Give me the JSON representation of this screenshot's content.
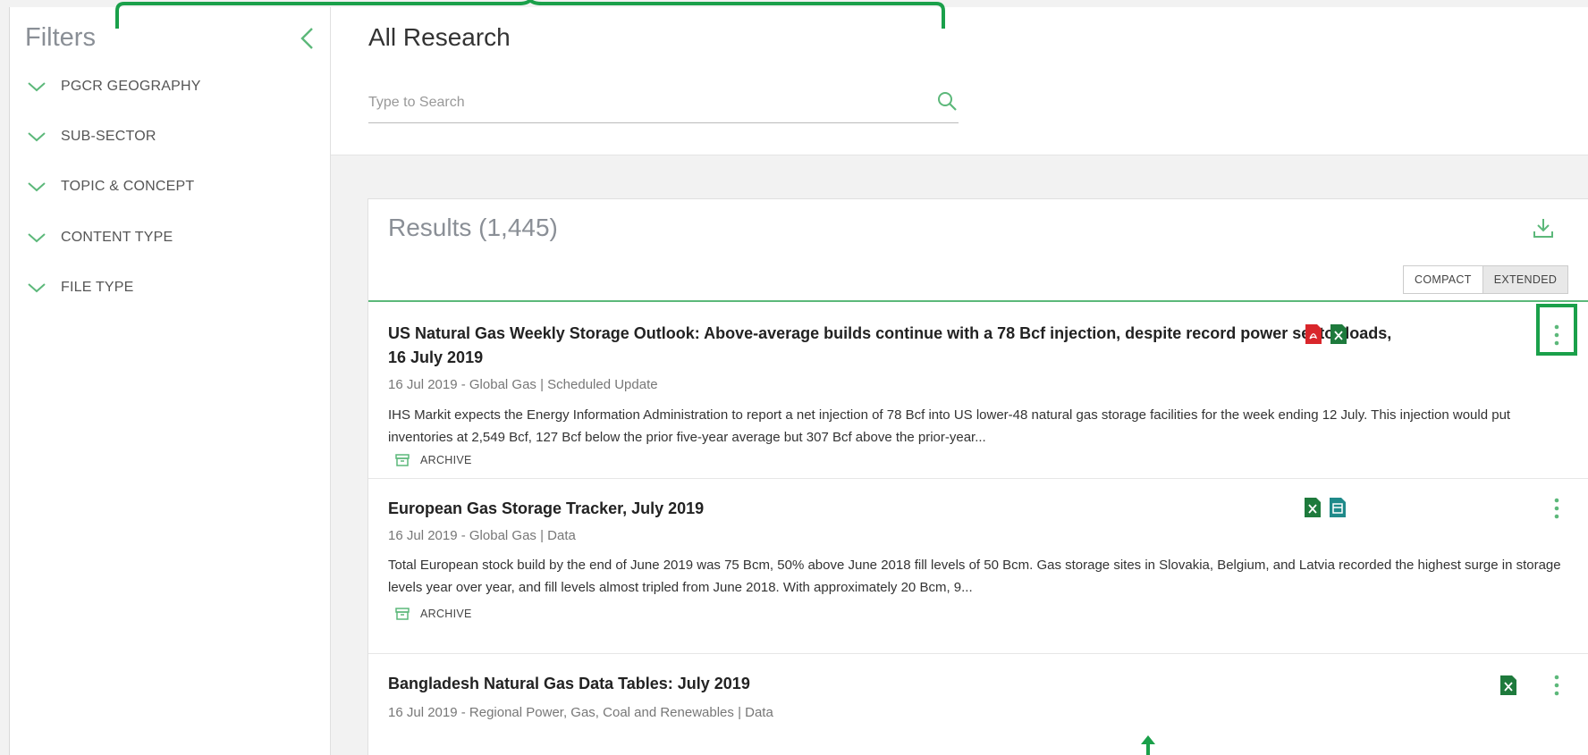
{
  "sidebar": {
    "title": "Filters",
    "filters": [
      {
        "label": "PGCR GEOGRAPHY"
      },
      {
        "label": "SUB-SECTOR"
      },
      {
        "label": "TOPIC & CONCEPT"
      },
      {
        "label": "CONTENT TYPE"
      },
      {
        "label": "FILE TYPE"
      }
    ]
  },
  "header": {
    "title": "All Research",
    "search": {
      "placeholder": "Type to Search",
      "value": ""
    }
  },
  "results": {
    "title": "Results (1,445)",
    "view_options": [
      "COMPACT",
      "EXTENDED"
    ],
    "active_view": "EXTENDED",
    "items": [
      {
        "title": "US Natural Gas Weekly Storage Outlook: Above-average builds continue with a 78 Bcf injection, despite record power sector loads, 16 July 2019",
        "meta": "16 Jul 2019 - Global Gas | Scheduled Update",
        "description": "IHS Markit expects the Energy Information Administration to report a net injection of 78 Bcf into US lower-48 natural gas storage facilities for the week ending 12 July. This injection would put inventories at 2,549 Bcf, 127 Bcf below the prior five-year average but 307 Bcf above the prior-year...",
        "archive_label": "ARCHIVE",
        "file_icons": [
          "pdf-icon",
          "excel-icon"
        ]
      },
      {
        "title": "European Gas Storage Tracker, July 2019",
        "meta": "16 Jul 2019 - Global Gas | Data",
        "description": "Total European stock build by the end of June 2019 was 75 Bcm, 50% above June 2018 fill levels of 50 Bcm. Gas storage sites in Slovakia, Belgium, and Latvia recorded the highest surge in storage levels year over year, and fill levels almost tripled from June 2018. With approximately 20 Bcm, 9...",
        "archive_label": "ARCHIVE",
        "file_icons": [
          "excel-icon",
          "data-file-icon"
        ]
      },
      {
        "title": "Bangladesh Natural Gas Data Tables: July 2019",
        "meta": "16 Jul 2019 - Regional Power, Gas, Coal and Renewables | Data",
        "file_icons": [
          "excel-icon"
        ]
      }
    ]
  },
  "colors": {
    "accent": "#5cb87a",
    "annotation_green": "#1aa04a",
    "pdf_red": "#d9262b",
    "excel_green": "#1e7a3c",
    "data_teal": "#1f8a8a"
  }
}
